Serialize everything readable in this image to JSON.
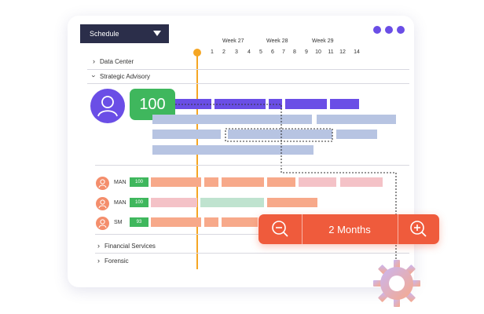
{
  "toolbar": {
    "schedule_label": "Schedule",
    "more_icon": "three-dots-icon"
  },
  "timeline": {
    "weeks": [
      "Week 27",
      "Week 28",
      "Week 29"
    ],
    "days": [
      "1",
      "2",
      "3",
      "4",
      "5",
      "6",
      "7",
      "8",
      "9",
      "10",
      "11",
      "12",
      "14"
    ]
  },
  "sections": {
    "data_center": "Data Center",
    "strategic_advisory": "Strategic Advisory",
    "financial_services": "Financial Services",
    "forensic": "Forensic"
  },
  "team": {
    "score": "100",
    "members": [
      {
        "initials": "MAN",
        "score": "100"
      },
      {
        "initials": "MAN",
        "score": "100"
      },
      {
        "initials": "SM",
        "score": "93"
      }
    ]
  },
  "zoom": {
    "label": "2 Months",
    "zoom_out_icon": "zoom-out-icon",
    "zoom_in_icon": "zoom-in-icon"
  },
  "colors": {
    "accent": "#6a4ee6",
    "dark": "#2b2e4a",
    "orange": "#ef5b3c",
    "green": "#3fb75d",
    "timeline_marker": "#f5a623"
  }
}
